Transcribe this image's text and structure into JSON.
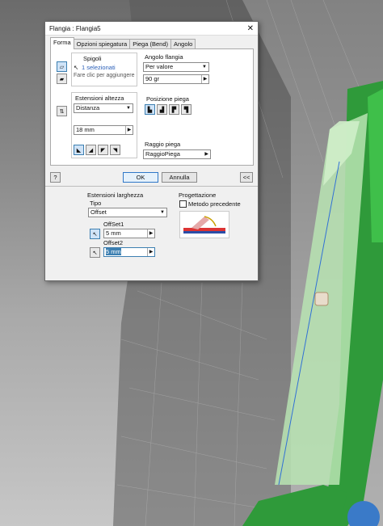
{
  "window": {
    "title": "Flangia : Flangia5",
    "close": "✕"
  },
  "tabs": [
    {
      "label": "Forma"
    },
    {
      "label": "Opzioni spiegatura"
    },
    {
      "label": "Piega (Bend)"
    },
    {
      "label": "Angolo"
    }
  ],
  "spigoli": {
    "title": "Spigoli",
    "selected": "1 selezionati",
    "hint": "Fare clic per aggiungere"
  },
  "angolo_flangia": {
    "title": "Angolo flangia",
    "mode": "Per valore",
    "value": "90 gr"
  },
  "estensioni_altezza": {
    "title": "Estensioni altezza",
    "mode": "Distanza",
    "value": "18 mm"
  },
  "posizione_piega": {
    "title": "Posizione piega"
  },
  "raggio_piega": {
    "title": "Raggio piega",
    "value": "RaggioPiega"
  },
  "buttons": {
    "help": "?",
    "ok": "OK",
    "cancel": "Annulla",
    "collapse": "<<"
  },
  "estensioni_larghezza": {
    "title": "Estensioni larghezza",
    "tipo_label": "Tipo",
    "tipo_value": "Offset",
    "offset1_label": "OffSet1",
    "offset1_value": "5 mm",
    "offset2_label": "Offset2",
    "offset2_value": "5 mm"
  },
  "progettazione": {
    "title": "Progettazione",
    "checkbox_label": "Metodo precedente",
    "checked": false
  },
  "colors": {
    "dialog_bg": "#f0f0f0",
    "selection_blue": "#3c7fb1",
    "model_green": "#2f9a3a",
    "model_light_green": "#b9e4b3"
  }
}
